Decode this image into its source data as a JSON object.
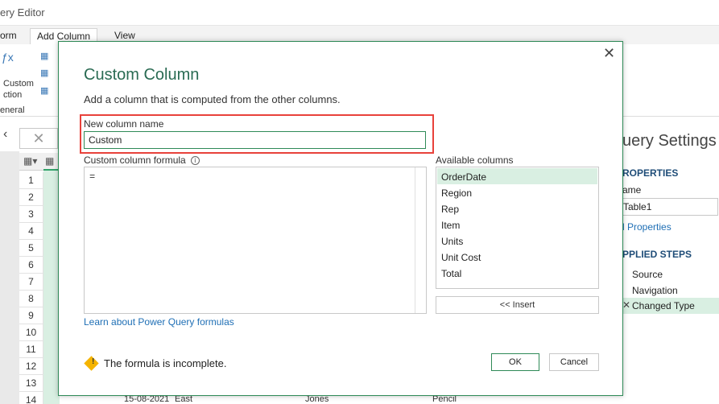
{
  "window": {
    "title": "ery Editor",
    "tabs": [
      "orm",
      "Add Column",
      "View"
    ]
  },
  "ribbon": {
    "custom_fn_line1": "Custom",
    "custom_fn_line2": "ction",
    "group_label": "eneral"
  },
  "formula_bar": {
    "cancel_glyph": "✕",
    "expand_glyph": "‹"
  },
  "grid": {
    "rows": [
      "1",
      "2",
      "3",
      "4",
      "5",
      "6",
      "7",
      "8",
      "9",
      "10",
      "11",
      "12",
      "13",
      "14"
    ],
    "bottom_row": {
      "date": "15-08-2021",
      "region": "East",
      "rep": "Jones",
      "item": "Pencil"
    }
  },
  "query_settings": {
    "title": "uery Settings",
    "properties_header": "ROPERTIES",
    "name_label": "ame",
    "name_value": "Table1",
    "all_properties_link": "l Properties",
    "applied_steps_header": "PPLIED STEPS",
    "steps": [
      "Source",
      "Navigation",
      "Changed Type"
    ]
  },
  "dialog": {
    "title": "Custom Column",
    "subtitle": "Add a column that is computed from the other columns.",
    "new_column_name_label": "New column name",
    "new_column_name_value": "Custom",
    "formula_label": "Custom column formula",
    "formula_value": "=",
    "available_columns_label": "Available columns",
    "available_columns": [
      "OrderDate",
      "Region",
      "Rep",
      "Item",
      "Units",
      "Unit Cost",
      "Total"
    ],
    "selected_column": "OrderDate",
    "insert_label": "<< Insert",
    "learn_link": "Learn about Power Query formulas",
    "warning": "The formula is incomplete.",
    "ok_label": "OK",
    "cancel_label": "Cancel",
    "close_glyph": "✕",
    "info_glyph": "i"
  },
  "colors": {
    "accent_green": "#2f8a57",
    "highlight_red": "#e8423b",
    "selection_green": "#d9efe2",
    "link_blue": "#1f6fb5"
  }
}
